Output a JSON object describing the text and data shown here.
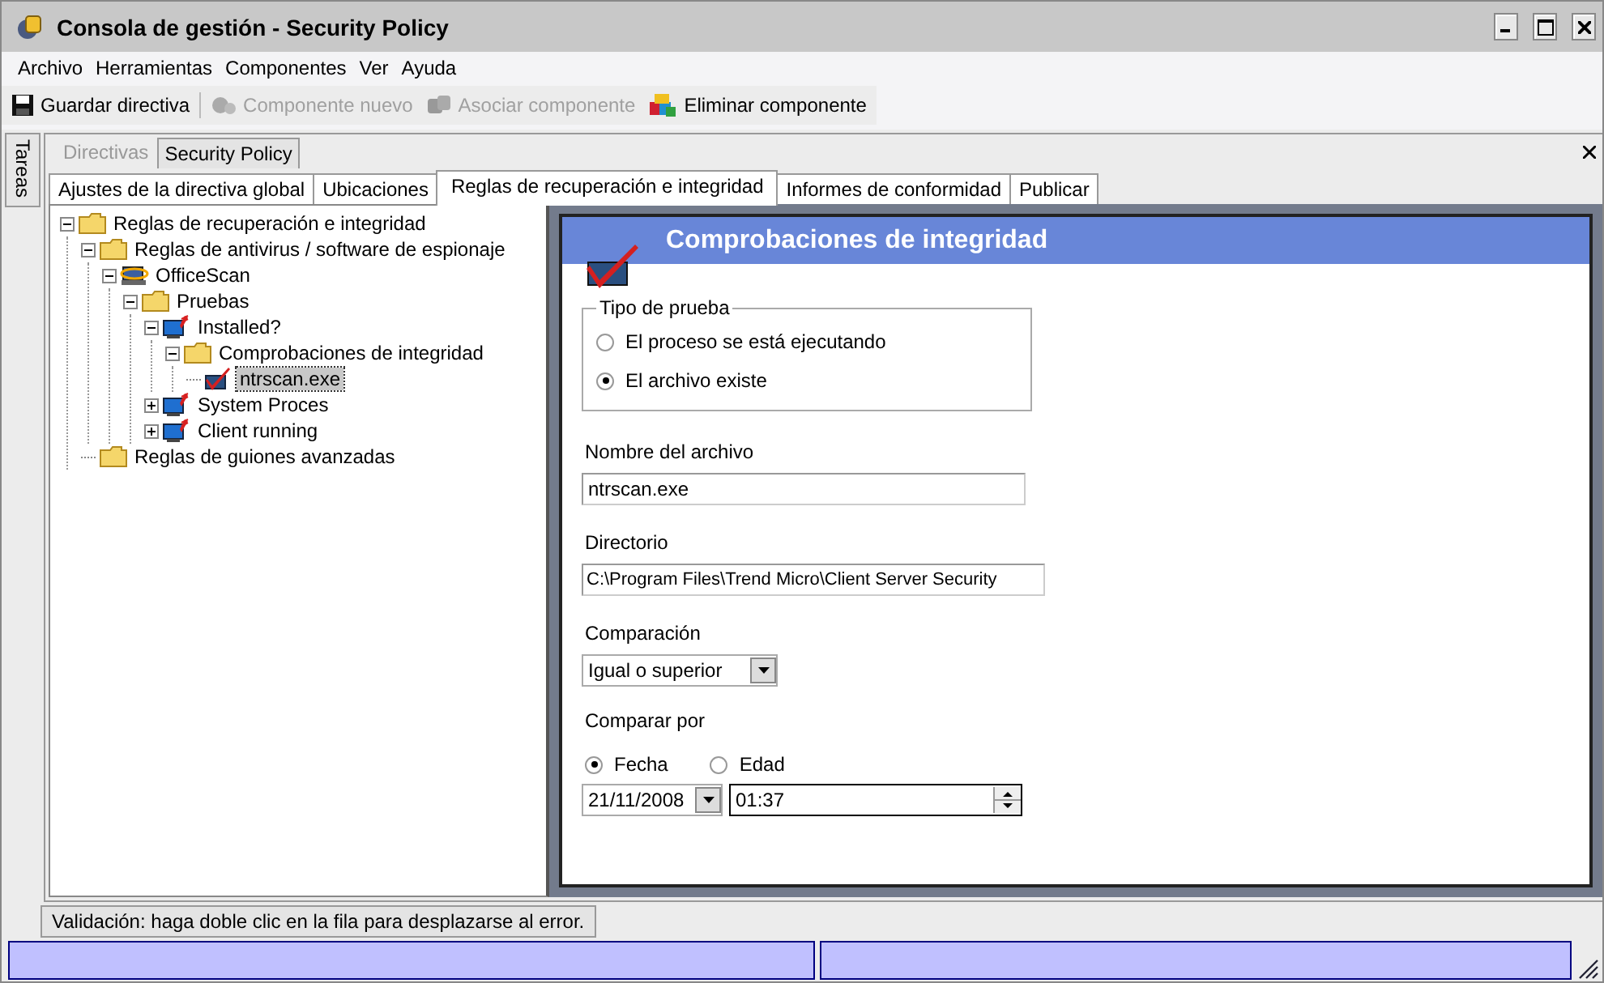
{
  "window": {
    "title": "Consola de gestión - Security Policy"
  },
  "menu": [
    "Archivo",
    "Herramientas",
    "Componentes",
    "Ver",
    "Ayuda"
  ],
  "toolbar": [
    {
      "label": "Guardar directiva",
      "kind": "save",
      "disabled": false
    },
    {
      "label": "Componente nuevo",
      "kind": "new",
      "disabled": true
    },
    {
      "label": "Asociar componente",
      "kind": "associate",
      "disabled": true
    },
    {
      "label": "Eliminar componente",
      "kind": "delete",
      "disabled": false
    }
  ],
  "side_tab": "Tareas",
  "doc_tabs": [
    {
      "label": "Directivas",
      "selected": false
    },
    {
      "label": "Security Policy",
      "selected": true
    }
  ],
  "tabs": [
    {
      "label": "Ajustes de la directiva global",
      "selected": false
    },
    {
      "label": "Ubicaciones",
      "selected": false
    },
    {
      "label": "Reglas de recuperación e integridad",
      "selected": true
    },
    {
      "label": "Informes de conformidad",
      "selected": false
    },
    {
      "label": "Publicar",
      "selected": false
    }
  ],
  "tree": [
    {
      "label": "Reglas de recuperación e integridad",
      "kind": "folder",
      "expanded": true,
      "selected": false,
      "children": [
        {
          "label": "Reglas de antivirus / software de espionaje",
          "kind": "folder",
          "expanded": true,
          "selected": false,
          "children": [
            {
              "label": "OfficeScan",
              "kind": "product",
              "expanded": true,
              "selected": false,
              "children": [
                {
                  "label": "Pruebas",
                  "kind": "folder",
                  "expanded": true,
                  "selected": false,
                  "children": [
                    {
                      "label": "Installed?",
                      "kind": "test",
                      "expanded": true,
                      "selected": false,
                      "children": [
                        {
                          "label": "Comprobaciones de integridad",
                          "kind": "folder",
                          "expanded": true,
                          "selected": false,
                          "children": [
                            {
                              "label": "ntrscan.exe",
                              "kind": "check",
                              "selected": true
                            }
                          ]
                        }
                      ]
                    },
                    {
                      "label": "System Proces",
                      "kind": "test",
                      "expanded": false,
                      "selected": false
                    },
                    {
                      "label": "Client running",
                      "kind": "test",
                      "expanded": false,
                      "selected": false
                    }
                  ]
                }
              ]
            }
          ]
        },
        {
          "label": "Reglas de guiones avanzadas",
          "kind": "folder",
          "selected": false
        }
      ]
    }
  ],
  "detail": {
    "title": "Comprobaciones de integridad",
    "test_type": {
      "legend": "Tipo de prueba",
      "options": [
        {
          "label": "El proceso se está ejecutando",
          "selected": false
        },
        {
          "label": "El archivo existe",
          "selected": true
        }
      ]
    },
    "file_name": {
      "label": "Nombre del archivo",
      "value": "ntrscan.exe"
    },
    "directory": {
      "label": "Directorio",
      "value": "C:\\Program Files\\Trend Micro\\Client Server Security"
    },
    "comparison": {
      "label": "Comparación",
      "value": "Igual o superior"
    },
    "compare_by": {
      "label": "Comparar por",
      "options": [
        {
          "label": "Fecha",
          "selected": true
        },
        {
          "label": "Edad",
          "selected": false
        }
      ],
      "date": "21/11/2008",
      "time": "01:37"
    }
  },
  "validation_tab": "Validación: haga doble clic en la fila para desplazarse al error."
}
